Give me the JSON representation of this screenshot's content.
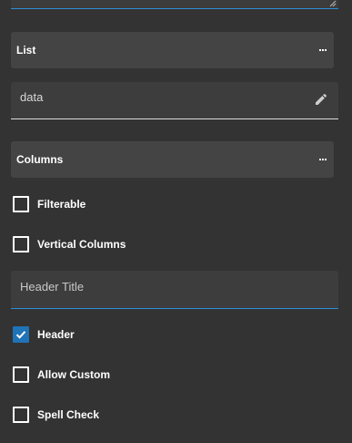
{
  "list_section": {
    "title": "List"
  },
  "data_field": {
    "value": "data"
  },
  "columns_section": {
    "title": "Columns"
  },
  "options_top": [
    {
      "label": "Filterable",
      "checked": false
    },
    {
      "label": "Vertical Columns",
      "checked": false
    }
  ],
  "header_title_field": {
    "placeholder": "Header Title"
  },
  "options_bottom": [
    {
      "label": "Header",
      "checked": true
    },
    {
      "label": "Allow Custom",
      "checked": false
    },
    {
      "label": "Spell Check",
      "checked": false
    }
  ],
  "colors": {
    "accent": "#2b8fd6",
    "checked": "#1f73b7",
    "background": "#333333",
    "panel": "#444444"
  },
  "icons": {
    "more": "more-horizontal-icon",
    "edit": "pencil-icon",
    "check": "checkmark-icon",
    "grip": "resize-grip-icon"
  }
}
